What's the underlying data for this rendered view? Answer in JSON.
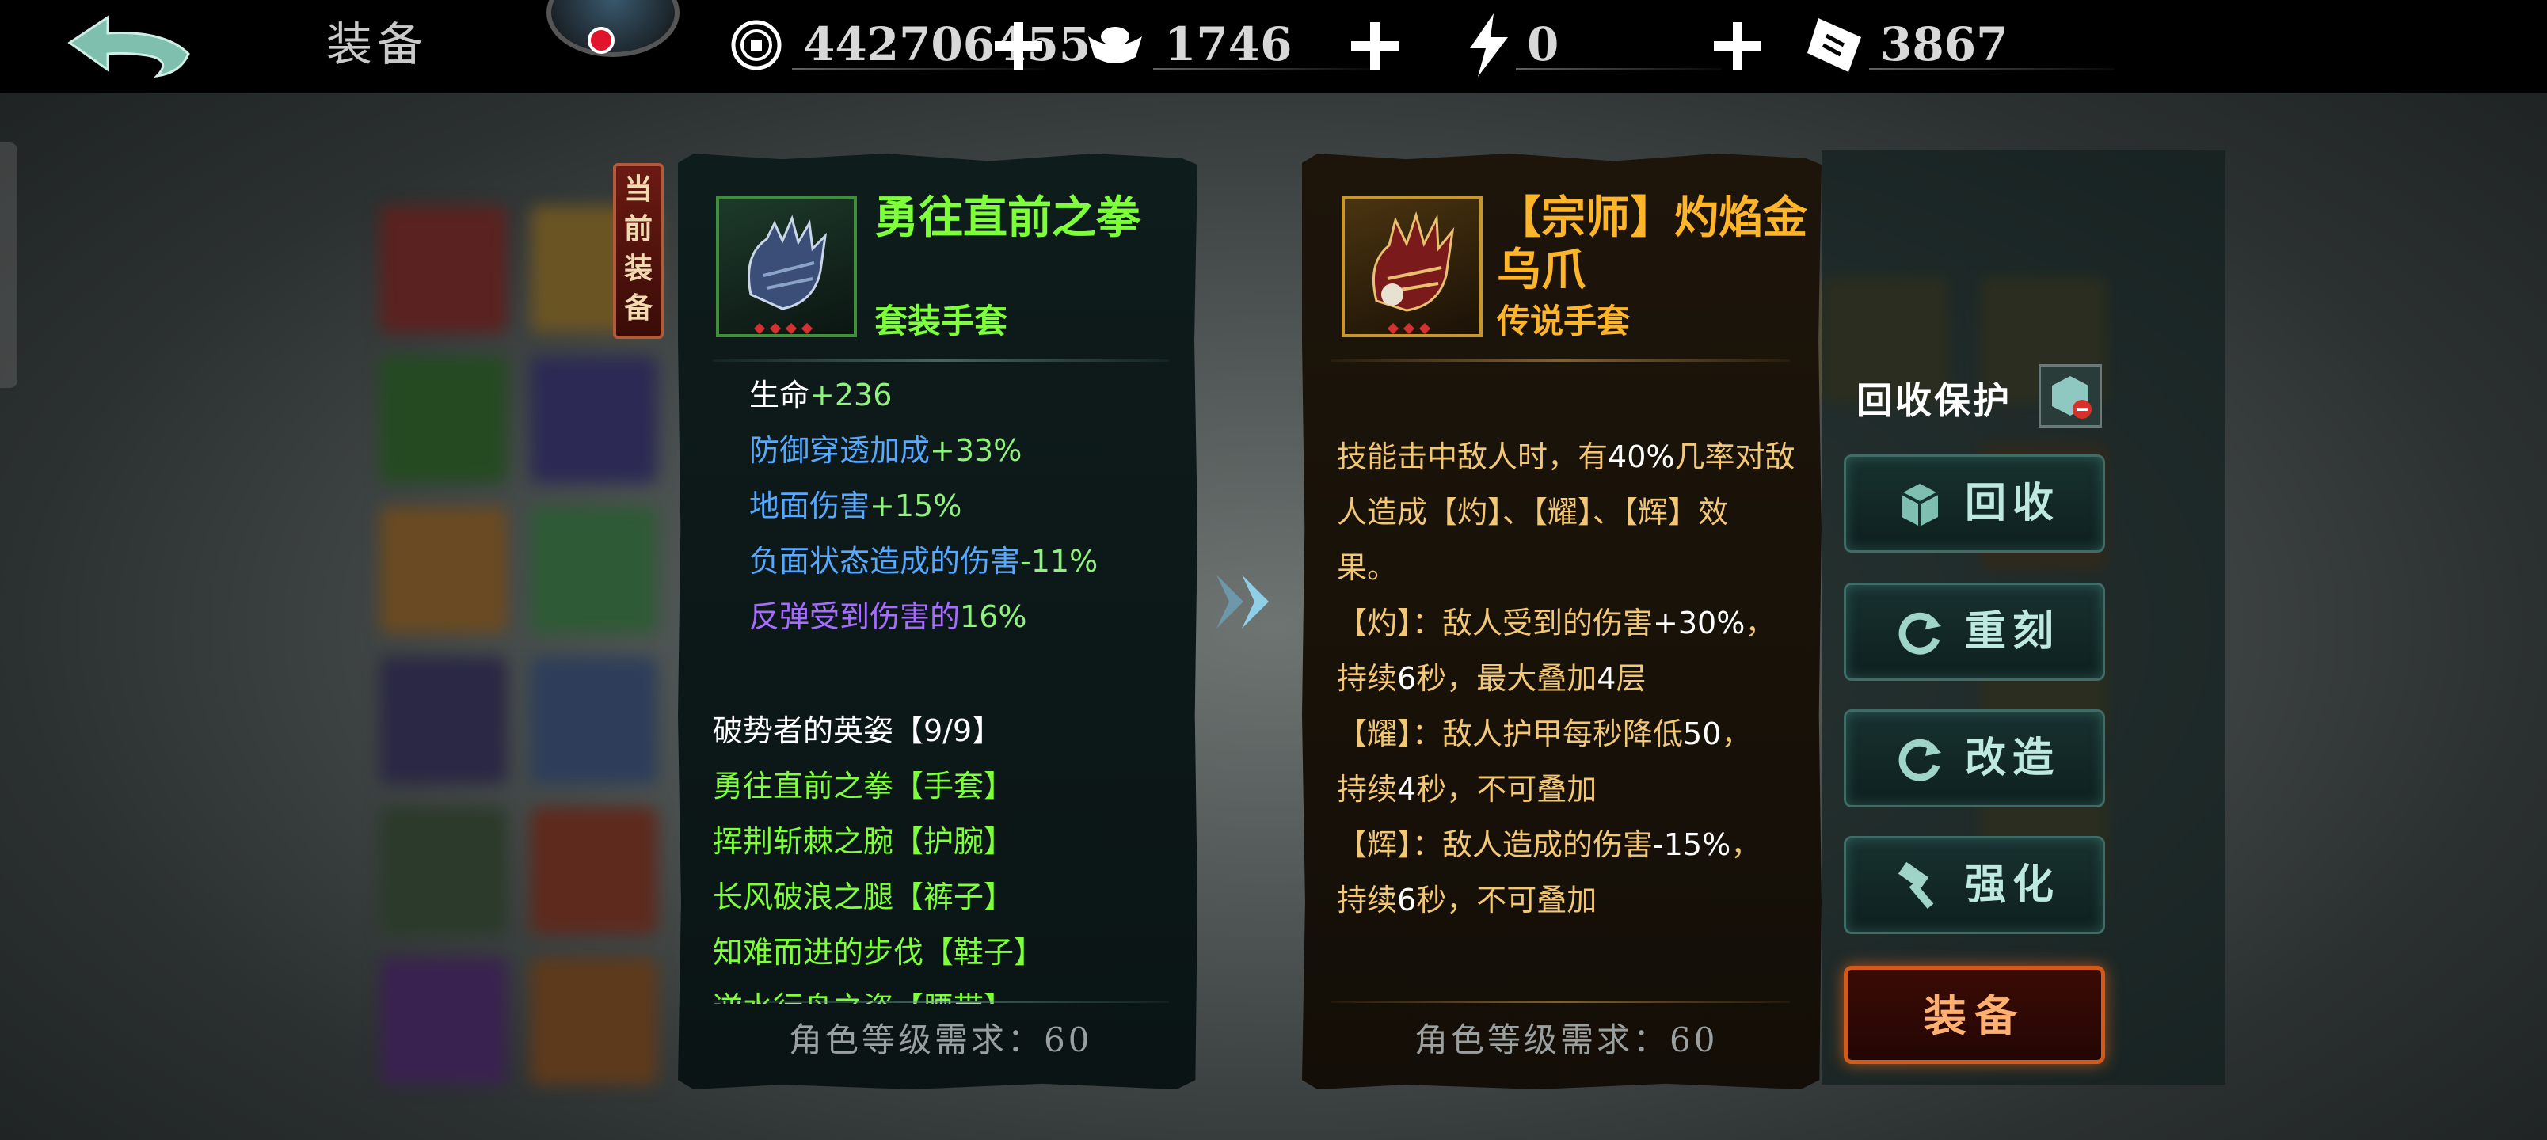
{
  "topbar": {
    "title": "装备",
    "currencies": [
      {
        "icon": "coin-icon",
        "value": "442706455"
      },
      {
        "icon": "ingot-icon",
        "value": "1746"
      },
      {
        "icon": "lightning-icon",
        "value": "0"
      },
      {
        "icon": "ticket-icon",
        "value": "3867"
      }
    ]
  },
  "current_badge": "当前装备",
  "current_item": {
    "name": "勇往直前之拳",
    "type": "套装手套",
    "stats": [
      {
        "text": "生命",
        "value": "+236",
        "color": "#ffffff"
      },
      {
        "text": "防御穿透加成",
        "value": "+33%",
        "color": "#57a8ff"
      },
      {
        "text": "地面伤害",
        "value": "+15%",
        "color": "#57a8ff"
      },
      {
        "text": "负面状态造成的伤害",
        "value": "-11%",
        "color": "#57a8ff"
      },
      {
        "text": "反弹受到伤害的",
        "value": "16%",
        "color": "#a66cff"
      }
    ],
    "set_title": "破势者的英姿【9/9】",
    "set_items": [
      "勇往直前之拳【手套】",
      "挥荆斩棘之腕【护腕】",
      "长风破浪之腿【裤子】",
      "知难而进的步伐【鞋子】",
      "逆水行舟之姿【腰带】"
    ],
    "requirement": "角色等级需求：60"
  },
  "new_item": {
    "name": "【宗师】灼焰金乌爪",
    "type": "传说手套",
    "desc_lines": [
      [
        "技能击中敌人时，有",
        "40%",
        "几率对敌"
      ],
      [
        "人造成【灼】、【耀】、【辉】效",
        "",
        ""
      ],
      [
        "果。",
        "",
        ""
      ],
      [
        "【灼】：敌人受到的伤害",
        "+30%",
        "，"
      ],
      [
        "持续",
        "6",
        "秒，最大叠加",
        "4",
        "层"
      ],
      [
        "【耀】：敌人护甲每秒降低",
        "50",
        "，"
      ],
      [
        "持续",
        "4",
        "秒，不可叠加"
      ],
      [
        "【辉】：敌人造成的伤害",
        "-15%",
        "，"
      ],
      [
        "持续",
        "6",
        "秒，不可叠加"
      ]
    ],
    "requirement": "角色等级需求：60"
  },
  "actions": {
    "recycle_protect": "回收保护",
    "buttons": [
      {
        "label": "回收",
        "icon": "recycle-cube-icon"
      },
      {
        "label": "重刻",
        "icon": "refresh-icon"
      },
      {
        "label": "改造",
        "icon": "refresh-icon"
      },
      {
        "label": "强化",
        "icon": "hammer-icon"
      }
    ],
    "equip": "装备"
  },
  "colors": {
    "green_name": "#7dff3a",
    "gold_name": "#ffb52a",
    "stat_green": "#8ef27c",
    "desc_text": "#f2c776",
    "desc_value": "#ffffff"
  }
}
